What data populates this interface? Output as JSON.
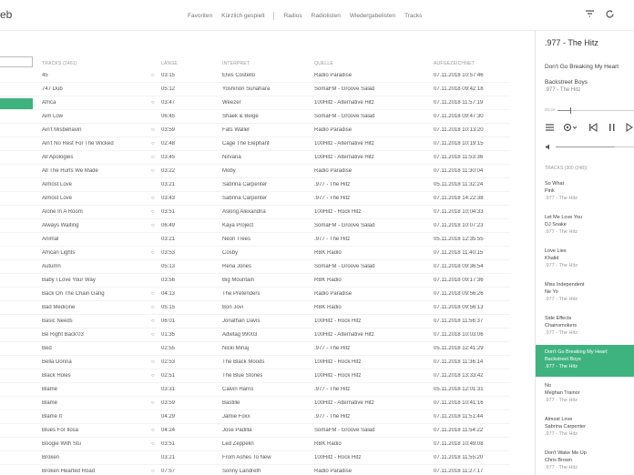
{
  "header": {
    "app_title_partial": "eb",
    "nav": [
      "Favoriten",
      "Kürzlich gespielt",
      "Radios",
      "Radiolisten",
      "Wiedergabelisten",
      "Tracks"
    ],
    "icons": [
      "filter-icon",
      "refresh-icon"
    ]
  },
  "table": {
    "columns": [
      "TRACKS (2461)",
      "LÄNGE",
      "INTERPRET",
      "QUELLE",
      "AUFGEZEICHNET"
    ],
    "rows": [
      {
        "title": "45",
        "fav": "○",
        "length": "03:15",
        "artist": "Elvis Costello",
        "source": "Radio Paradise",
        "date": "07.11.2018 10:57:46"
      },
      {
        "title": "747 Dub",
        "fav": "",
        "length": "05:12",
        "artist": "Yoshinori Sunahara",
        "source": "SomaFM - Groove Salad",
        "date": "07.11.2018 09:42:18"
      },
      {
        "title": "Africa",
        "fav": "○",
        "length": "03:47",
        "artist": "Weezer",
        "source": "100Hitz - Alternative Hitz",
        "date": "07.11.2018 11:57:19"
      },
      {
        "title": "Aim Low",
        "fav": "",
        "length": "06:45",
        "artist": "Shaek & Beige",
        "source": "SomaFM - Groove Salad",
        "date": "07.11.2018 09:47:30"
      },
      {
        "title": "Ain't Misbehavin",
        "fav": "○",
        "length": "03:59",
        "artist": "Fats Waller",
        "source": "Radio Paradise",
        "date": "07.11.2018 10:13:20"
      },
      {
        "title": "Ain't No Rest For The Wicked",
        "fav": "○",
        "length": "02:48",
        "artist": "Cage The Elephant",
        "source": "100Hitz - Alternative Hitz",
        "date": "07.11.2018 10:19:15"
      },
      {
        "title": "All Apologies",
        "fav": "○",
        "length": "03:45",
        "artist": "Nirvana",
        "source": "100Hitz - Alternative Hitz",
        "date": "07.11.2018 11:53:36"
      },
      {
        "title": "All The Hurts We Made",
        "fav": "○",
        "length": "03:22",
        "artist": "Moby",
        "source": "Radio Paradise",
        "date": "07.11.2018 11:30:04"
      },
      {
        "title": "Almost Love",
        "fav": "",
        "length": "03:21",
        "artist": "Sabrina Carpenter",
        "source": ".977 - The Hitz",
        "date": "05.11.2018 11:32:24"
      },
      {
        "title": "Almost Love",
        "fav": "○",
        "length": "03:43",
        "artist": "Sabrina Carpenter",
        "source": ".977 - The Hitz",
        "date": "07.11.2018 14:22:38"
      },
      {
        "title": "Alone In A Room",
        "fav": "○",
        "length": "03:51",
        "artist": "Asking Alexandria",
        "source": "100Hitz - Rock Hitz",
        "date": "07.11.2018 10:04:33"
      },
      {
        "title": "Always Waiting",
        "fav": "○",
        "length": "06:49",
        "artist": "Kaya Project",
        "source": "SomaFM - Groove Salad",
        "date": "07.11.2018 10:07:23"
      },
      {
        "title": "Animal",
        "fav": "",
        "length": "03:21",
        "artist": "Neon Trees",
        "source": ".977 - The Hitz",
        "date": "05.11.2018 12:35:55"
      },
      {
        "title": "African Lights",
        "fav": "○",
        "length": "03:53",
        "artist": "Cosby",
        "source": "RBK Radio",
        "date": "07.11.2018 11:40:15"
      },
      {
        "title": "Autumn",
        "fav": "",
        "length": "05:13",
        "artist": "Rena Jones",
        "source": "SomaFM - Groove Salad",
        "date": "07.11.2018 09:36:54"
      },
      {
        "title": "Baby I Love Your Way",
        "fav": "",
        "length": "03:56",
        "artist": "Big Mountain",
        "source": "RBK Radio",
        "date": "07.11.2018 09:17:36"
      },
      {
        "title": "Back On The Chain Gang",
        "fav": "○",
        "length": "04:13",
        "artist": "The Pretenders",
        "source": "Radio Paradise",
        "date": "07.11.2018 09:56:26"
      },
      {
        "title": "Bad Medicine",
        "fav": "○",
        "length": "05:15",
        "artist": "Bon Jovi",
        "source": "RBK Radio",
        "date": "07.11.2018 09:56:13"
      },
      {
        "title": "Basic Needs",
        "fav": "○",
        "length": "06:01",
        "artist": "Jonathan Davis",
        "source": "100Hitz - Rock Hitz",
        "date": "07.11.2018 11:56:37"
      },
      {
        "title": "Be Right Back'03",
        "fav": "○",
        "length": "01:35",
        "artist": "Adwtag 99003",
        "source": "100Hitz - Alternative Hitz",
        "date": "07.11.2018 10:03:06"
      },
      {
        "title": "Bed",
        "fav": "",
        "length": "02:55",
        "artist": "Nicki Minaj",
        "source": ".977 - The Hitz",
        "date": "05.11.2018 12:41:29"
      },
      {
        "title": "Bella Donna",
        "fav": "○",
        "length": "02:53",
        "artist": "The Black Moods",
        "source": "100Hitz - Rock Hitz",
        "date": "07.11.2018 11:36:14"
      },
      {
        "title": "Black Holes",
        "fav": "○",
        "length": "02:51",
        "artist": "The Blue Stones",
        "source": "100Hitz - Rock Hitz",
        "date": "07.11.2018 13:33:42"
      },
      {
        "title": "Blame",
        "fav": "",
        "length": "03:31",
        "artist": "Calvin Harris",
        "source": ".977 - The Hitz",
        "date": "05.11.2018 12:01:31"
      },
      {
        "title": "Blame",
        "fav": "○",
        "length": "03:59",
        "artist": "Bastille",
        "source": "100Hitz - Alternative Hitz",
        "date": "07.11.2018 10:41:16"
      },
      {
        "title": "Blame It",
        "fav": "",
        "length": "04:29",
        "artist": "Jamie Foxx",
        "source": ".977 - The Hitz",
        "date": "07.11.2018 11:51:44"
      },
      {
        "title": "Blues For Ilosa",
        "fav": "○",
        "length": "04:24",
        "artist": "Jose Padilla",
        "source": "SomaFM - Groove Salad",
        "date": "07.11.2018 11:54:22"
      },
      {
        "title": "Boogie With Stu",
        "fav": "○",
        "length": "03:51",
        "artist": "Led Zeppelin",
        "source": "RBK Radio",
        "date": "07.11.2018 10:49:08"
      },
      {
        "title": "Broken",
        "fav": "",
        "length": "03:21",
        "artist": "From Ashes To New",
        "source": "100Hitz - Rock Hitz",
        "date": "07.11.2018 11:55:20"
      },
      {
        "title": "Broken Hearted Road",
        "fav": "○",
        "length": "07:57",
        "artist": "Sonny Landreth",
        "source": "Radio Paradise",
        "date": "07.11.2018 11:27:17"
      }
    ]
  },
  "panel": {
    "station": ".977 - The Hitz",
    "now_title": "Don't Go Breaking My Heart",
    "now_artist": "Backstreet Boys",
    "now_station": ".977 - The Hitz",
    "time_elapsed": "00:33",
    "progress": 0.16,
    "volume": 0.75,
    "tracks_header": "TRACKS (300 (248))",
    "playlist": [
      {
        "title": "So What",
        "artist": "Pink",
        "station": ".977 - The Hitz",
        "active": false
      },
      {
        "title": "Let Me Love You",
        "artist": "DJ Snake",
        "station": ".977 - The Hitz",
        "active": false
      },
      {
        "title": "Love Lies",
        "artist": "Khalid",
        "station": ".977 - The Hitz",
        "active": false
      },
      {
        "title": "Miss Independent",
        "artist": "Ne Yo",
        "station": ".977 - The Hitz",
        "active": false
      },
      {
        "title": "Side Effects",
        "artist": "Chainsmokers",
        "station": ".977 - The Hitz",
        "active": false
      },
      {
        "title": "Don't Go Breaking My Heart",
        "artist": "Backstreet Boys",
        "station": ".977 - The Hitz",
        "active": true
      },
      {
        "title": "No",
        "artist": "Meghan Trainor",
        "station": ".977 - The Hitz",
        "active": false
      },
      {
        "title": "Almost Love",
        "artist": "Sabrina Carpenter",
        "station": ".977 - The Hitz",
        "active": false
      },
      {
        "title": "Don't Wake Me Up",
        "artist": "Chris Brown",
        "station": ".977 - The Hitz",
        "active": false
      }
    ]
  },
  "colors": {
    "accent": "#3fb37f"
  }
}
